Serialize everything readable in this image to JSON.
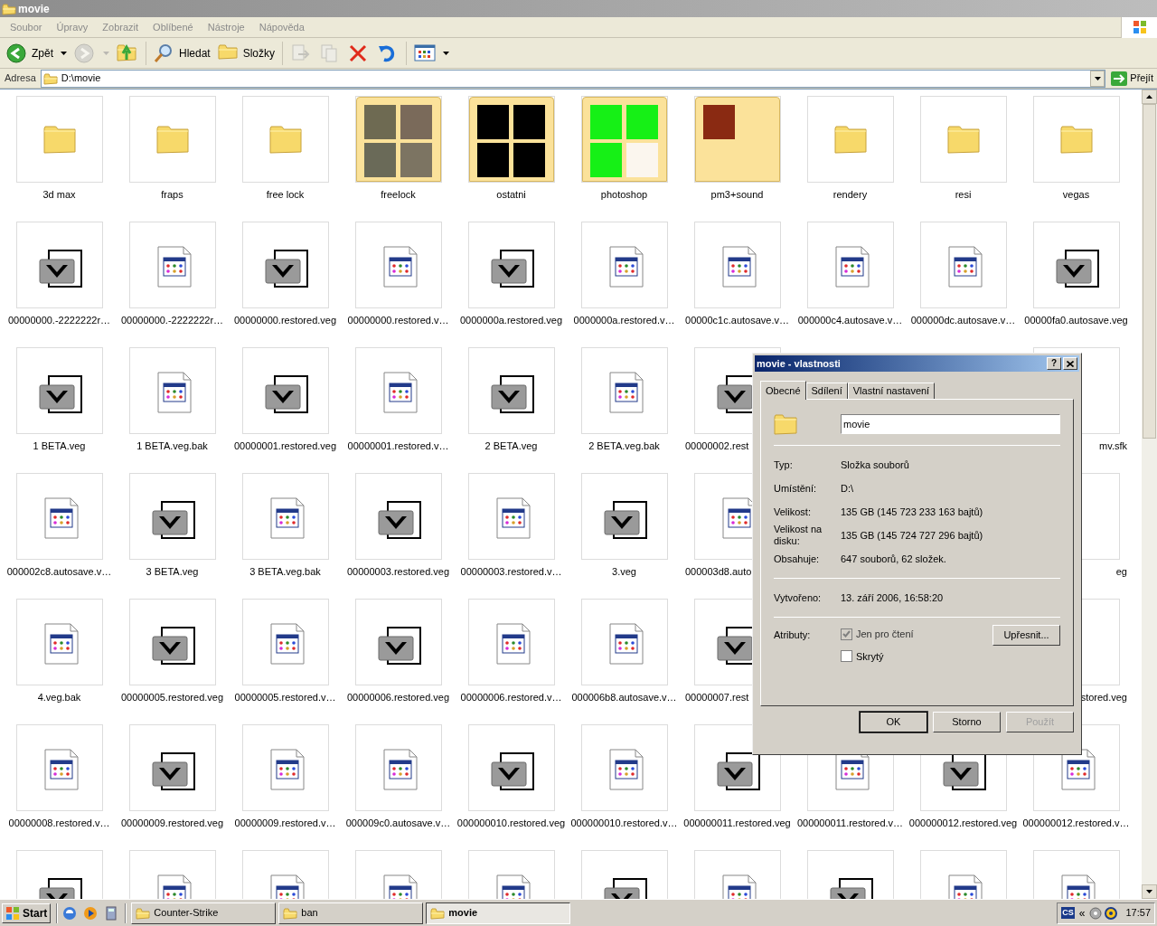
{
  "window": {
    "title": "movie"
  },
  "menu": [
    "Soubor",
    "Úpravy",
    "Zobrazit",
    "Oblíbené",
    "Nástroje",
    "Nápověda"
  ],
  "toolbar": [
    {
      "kind": "back",
      "label": "Zpět",
      "dropdown": true,
      "disabled": false
    },
    {
      "kind": "forward",
      "dropdown": true,
      "disabled": true
    },
    {
      "kind": "up",
      "dropdown": false,
      "disabled": false
    },
    {
      "kind": "separator"
    },
    {
      "kind": "search",
      "label": "Hledat",
      "dropdown": false,
      "disabled": false
    },
    {
      "kind": "folders",
      "label": "Složky",
      "dropdown": false,
      "disabled": false
    },
    {
      "kind": "separator"
    },
    {
      "kind": "move",
      "dropdown": false,
      "disabled": true
    },
    {
      "kind": "copy",
      "dropdown": false,
      "disabled": true
    },
    {
      "kind": "delete",
      "dropdown": false,
      "disabled": false
    },
    {
      "kind": "undo",
      "dropdown": false,
      "disabled": false
    },
    {
      "kind": "separator"
    },
    {
      "kind": "views",
      "dropdown": true,
      "disabled": false
    }
  ],
  "address": {
    "label": "Adresa",
    "value": "D:\\movie",
    "go": "Přejít"
  },
  "rows": [
    [
      {
        "kind": "folder",
        "label": "3d max"
      },
      {
        "kind": "folder",
        "label": "fraps"
      },
      {
        "kind": "folder",
        "label": "free lock"
      },
      {
        "kind": "preview_folder",
        "label": "freelock",
        "previews": [
          {
            "color": "#6e6a52"
          },
          {
            "color": "#7a6a5a"
          },
          {
            "color": "#6a6a58"
          },
          {
            "color": "#7c7462"
          }
        ]
      },
      {
        "kind": "preview_folder",
        "label": "ostatni",
        "previews": [
          {
            "color": "#000000"
          },
          {
            "color": "#000000"
          },
          {
            "color": "#000000"
          },
          {
            "color": "#000000"
          }
        ]
      },
      {
        "kind": "preview_folder",
        "label": "photoshop",
        "previews": [
          {
            "color": "#16f016"
          },
          {
            "color": "#16f016"
          },
          {
            "color": "#16f016"
          },
          {
            "color": "#fbf6ee"
          }
        ]
      },
      {
        "kind": "preview_folder",
        "label": "pm3+sound",
        "previews": [
          {
            "color": "#8a2a12"
          }
        ]
      },
      {
        "kind": "folder",
        "label": "rendery"
      },
      {
        "kind": "folder",
        "label": "resi"
      },
      {
        "kind": "folder",
        "label": "vegas"
      }
    ],
    [
      {
        "kind": "veg",
        "label": "00000000.-2222222r…"
      },
      {
        "kind": "doc",
        "label": "00000000.-2222222r…"
      },
      {
        "kind": "veg",
        "label": "00000000.restored.veg"
      },
      {
        "kind": "doc",
        "label": "00000000.restored.v…"
      },
      {
        "kind": "veg",
        "label": "0000000a.restored.veg"
      },
      {
        "kind": "doc",
        "label": "0000000a.restored.v…"
      },
      {
        "kind": "doc",
        "label": "00000c1c.autosave.v…"
      },
      {
        "kind": "doc",
        "label": "000000c4.autosave.v…"
      },
      {
        "kind": "doc",
        "label": "000000dc.autosave.v…"
      },
      {
        "kind": "veg",
        "label": "00000fa0.autosave.veg"
      }
    ],
    [
      {
        "kind": "veg",
        "label": "1 BETA.veg"
      },
      {
        "kind": "doc",
        "label": "1 BETA.veg.bak"
      },
      {
        "kind": "veg",
        "label": "00000001.restored.veg"
      },
      {
        "kind": "doc",
        "label": "00000001.restored.v…"
      },
      {
        "kind": "veg",
        "label": "2 BETA.veg"
      },
      {
        "kind": "doc",
        "label": "2 BETA.veg.bak"
      },
      {
        "kind": "veg",
        "label": "00000002.rest",
        "clipped_right": true
      },
      {
        "kind": "hidden"
      },
      {
        "kind": "hidden"
      },
      {
        "kind": "doc",
        "label": "mv.sfk",
        "clipped_left": true
      }
    ],
    [
      {
        "kind": "doc",
        "label": "000002c8.autosave.v…"
      },
      {
        "kind": "veg",
        "label": "3 BETA.veg"
      },
      {
        "kind": "doc",
        "label": "3 BETA.veg.bak"
      },
      {
        "kind": "veg",
        "label": "00000003.restored.veg"
      },
      {
        "kind": "doc",
        "label": "00000003.restored.v…"
      },
      {
        "kind": "veg",
        "label": "3.veg"
      },
      {
        "kind": "doc",
        "label": "000003d8.auto",
        "clipped_right": true
      },
      {
        "kind": "hidden"
      },
      {
        "kind": "hidden"
      },
      {
        "kind": "veg",
        "label": "eg",
        "clipped_left": true
      }
    ],
    [
      {
        "kind": "doc",
        "label": "4.veg.bak"
      },
      {
        "kind": "veg",
        "label": "00000005.restored.veg"
      },
      {
        "kind": "doc",
        "label": "00000005.restored.v…"
      },
      {
        "kind": "veg",
        "label": "00000006.restored.veg"
      },
      {
        "kind": "doc",
        "label": "00000006.restored.v…"
      },
      {
        "kind": "doc",
        "label": "000006b8.autosave.v…"
      },
      {
        "kind": "veg",
        "label": "00000007.rest",
        "clipped_right": true
      },
      {
        "kind": "hidden"
      },
      {
        "kind": "hidden"
      },
      {
        "kind": "veg",
        "label": "stored.veg",
        "clipped_left": true
      }
    ],
    [
      {
        "kind": "doc",
        "label": "00000008.restored.v…"
      },
      {
        "kind": "veg",
        "label": "00000009.restored.veg"
      },
      {
        "kind": "doc",
        "label": "00000009.restored.v…"
      },
      {
        "kind": "doc",
        "label": "000009c0.autosave.v…"
      },
      {
        "kind": "veg",
        "label": "000000010.restored.veg"
      },
      {
        "kind": "doc",
        "label": "000000010.restored.v…"
      },
      {
        "kind": "veg",
        "label": "000000011.restored.veg"
      },
      {
        "kind": "doc",
        "label": "000000011.restored.v…"
      },
      {
        "kind": "veg",
        "label": "000000012.restored.veg"
      },
      {
        "kind": "doc",
        "label": "000000012.restored.v…"
      }
    ],
    [
      {
        "kind": "veg"
      },
      {
        "kind": "doc"
      },
      {
        "kind": "doc"
      },
      {
        "kind": "doc"
      },
      {
        "kind": "doc"
      },
      {
        "kind": "veg"
      },
      {
        "kind": "doc"
      },
      {
        "kind": "veg"
      },
      {
        "kind": "doc"
      },
      {
        "kind": "doc"
      }
    ]
  ],
  "dialog": {
    "title": "movie - vlastnosti",
    "help": "?",
    "tabs": [
      {
        "label": "Obecné",
        "selected": true
      },
      {
        "label": "Sdílení",
        "selected": false
      },
      {
        "label": "Vlastní nastavení",
        "selected": false
      }
    ],
    "name": "movie",
    "groups": [
      [
        {
          "label": "Typ:",
          "value": "Složka souborů"
        },
        {
          "label": "Umístění:",
          "value": "D:\\"
        },
        {
          "label": "Velikost:",
          "value": "135 GB (145 723 233 163 bajtů)"
        },
        {
          "label": "Velikost na disku:",
          "value": "135 GB (145 724 727 296 bajtů)"
        },
        {
          "label": "Obsahuje:",
          "value": "647 souborů, 62 složek."
        }
      ],
      [
        {
          "label": "Vytvořeno:",
          "value": "13. září 2006, 16:58:20"
        }
      ]
    ],
    "attributes_label": "Atributy:",
    "attributes": [
      {
        "label": "Jen pro čtení",
        "checked": true,
        "disabled": true
      },
      {
        "label": "Skrytý",
        "checked": false,
        "disabled": false
      }
    ],
    "advanced": "Upřesnit...",
    "buttons": [
      {
        "label": "OK",
        "default": true,
        "disabled": false
      },
      {
        "label": "Storno",
        "default": false,
        "disabled": false
      },
      {
        "label": "Použít",
        "default": false,
        "disabled": true
      }
    ]
  },
  "taskbar": {
    "start": "Start",
    "quick_launch": [
      {
        "kind": "browser"
      },
      {
        "kind": "player"
      },
      {
        "kind": "calculator"
      }
    ],
    "tasks": [
      {
        "label": "Counter-Strike",
        "selected": false
      },
      {
        "label": "ban",
        "selected": false
      },
      {
        "label": "movie",
        "selected": true
      }
    ],
    "tray": {
      "badge": "CS",
      "expand": "«",
      "clock": "17:57"
    }
  }
}
